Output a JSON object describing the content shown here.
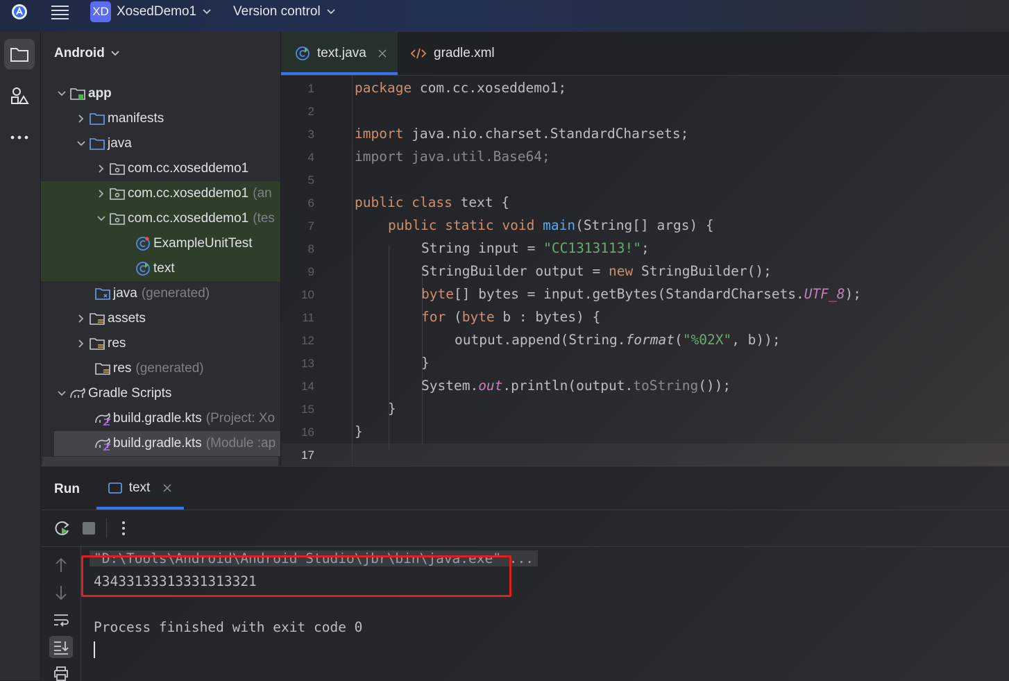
{
  "titlebar": {
    "project_badge": "XD",
    "project_name": "XosedDemo1",
    "version_control": "Version control"
  },
  "project_panel": {
    "title": "Android",
    "items": [
      {
        "label": "app",
        "suffix": ""
      },
      {
        "label": "manifests",
        "suffix": ""
      },
      {
        "label": "java",
        "suffix": ""
      },
      {
        "label": "com.cc.xoseddemo1",
        "suffix": ""
      },
      {
        "label": "com.cc.xoseddemo1",
        "suffix": "(an"
      },
      {
        "label": "com.cc.xoseddemo1",
        "suffix": "(tes"
      },
      {
        "label": "ExampleUnitTest",
        "suffix": ""
      },
      {
        "label": "text",
        "suffix": ""
      },
      {
        "label": "java",
        "suffix": "(generated)"
      },
      {
        "label": "assets",
        "suffix": ""
      },
      {
        "label": "res",
        "suffix": ""
      },
      {
        "label": "res",
        "suffix": "(generated)"
      },
      {
        "label": "Gradle Scripts",
        "suffix": ""
      },
      {
        "label": "build.gradle.kts",
        "suffix": "(Project: Xo"
      },
      {
        "label": "build.gradle.kts",
        "suffix": "(Module :ap"
      }
    ]
  },
  "editor": {
    "tabs": [
      {
        "label": "text.java"
      },
      {
        "label": "gradle.xml"
      }
    ],
    "line_numbers": [
      "1",
      "2",
      "3",
      "4",
      "5",
      "6",
      "7",
      "8",
      "9",
      "10",
      "11",
      "12",
      "13",
      "14",
      "15",
      "16",
      "17"
    ],
    "code": {
      "l1_kw": "package",
      "l1_rest": " com.cc.xoseddemo1;",
      "l3_kw": "import",
      "l3_rest": " java.nio.charset.StandardCharsets;",
      "l4": "import java.util.Base64;",
      "l6_kw1": "public",
      "l6_kw2": "class",
      "l6_rest": " text {",
      "l7_kw1": "public",
      "l7_kw2": "static",
      "l7_kw3": "void",
      "l7_fn": "main",
      "l7_rest": "(String[] args) {",
      "l8_a": "String input = ",
      "l8_str": "\"CC1313113!\"",
      "l8_b": ";",
      "l9_a": "StringBuilder output = ",
      "l9_kw": "new",
      "l9_b": " StringBuilder();",
      "l10_kw": "byte",
      "l10_a": "[] bytes = input.getBytes(StandardCharsets.",
      "l10_fld": "UTF_8",
      "l10_b": ");",
      "l11_kw1": "for",
      "l11_a": " (",
      "l11_kw2": "byte",
      "l11_b": " b : bytes) {",
      "l12_a": "output.append(String.",
      "l12_it": "format",
      "l12_b": "(",
      "l12_str": "\"%02X\"",
      "l12_c": ", b));",
      "l13": "}",
      "l14_a": "System.",
      "l14_fld": "out",
      "l14_b": ".println(output.",
      "l14_gray": "toString",
      "l14_c": "());",
      "l15": "}",
      "l16": "}"
    }
  },
  "run_panel": {
    "title": "Run",
    "tab_label": "text",
    "cmd_line": "\"D:\\Tools\\Android\\Android Studio\\jbr\\bin\\java.exe\" ...",
    "output_line": "43433133313331313321",
    "exit_line": "Process finished with exit code 0"
  }
}
